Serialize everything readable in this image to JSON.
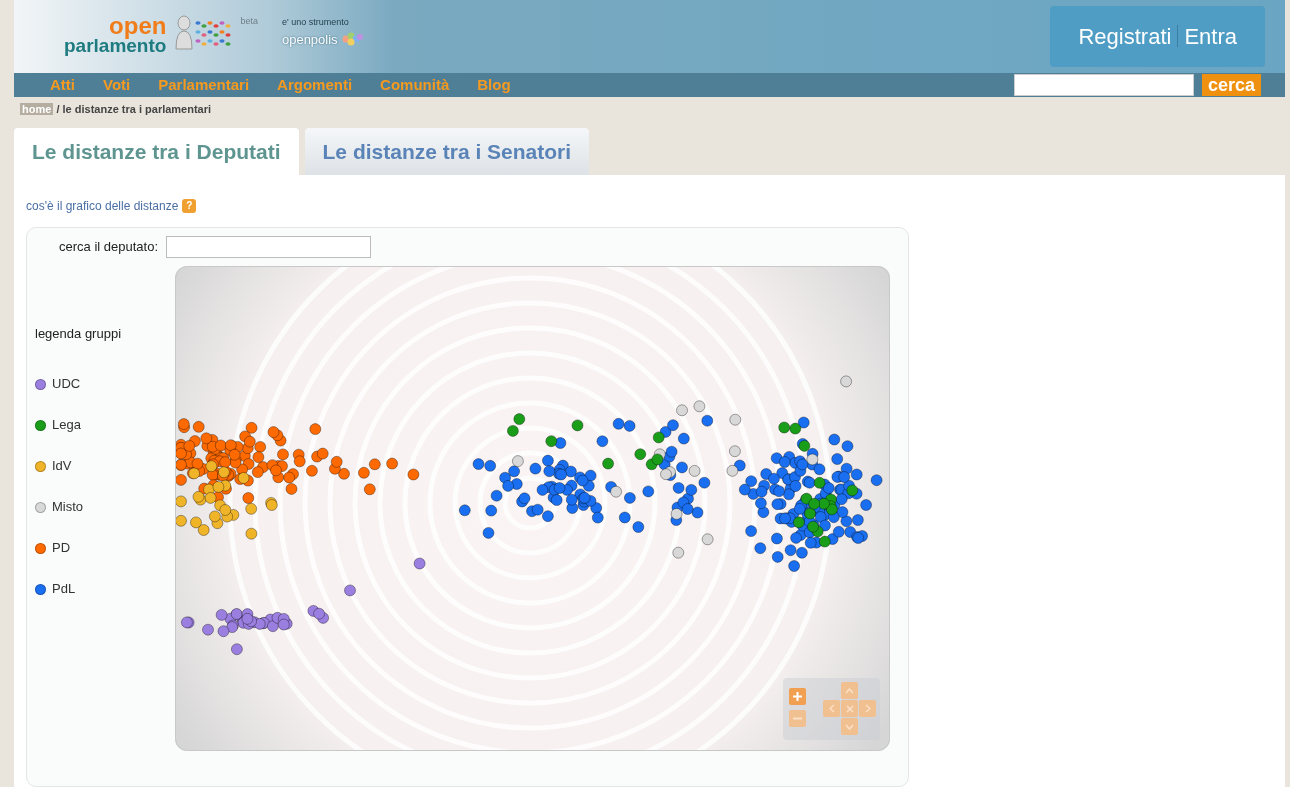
{
  "header": {
    "logo_top": "open",
    "logo_bottom": "parlamento",
    "beta": "beta",
    "tagline": "e' uno strumento",
    "openpolis": "openpolis",
    "auth_links": [
      "Registrati",
      "Entra"
    ]
  },
  "nav": {
    "items": [
      "Atti",
      "Voti",
      "Parlamentari",
      "Argomenti",
      "Comunità",
      "Blog"
    ],
    "search_button": "cerca"
  },
  "breadcrumb": {
    "home": "home",
    "current": "/ le distanze tra i parlamentari"
  },
  "tabs": [
    {
      "label": "Le distanze tra i Deputati",
      "selected": true
    },
    {
      "label": "Le distanze tra i Senatori",
      "selected": false
    }
  ],
  "help_link": "cos'è il grafico delle distanze",
  "help_icon": "?",
  "search_label": "cerca il deputato:",
  "legend": {
    "title": "legenda gruppi",
    "groups": [
      {
        "name": "UDC",
        "color": "#9b7fe0"
      },
      {
        "name": "Lega",
        "color": "#1a9e1a"
      },
      {
        "name": "IdV",
        "color": "#f0b429"
      },
      {
        "name": "Misto",
        "color": "#d8d8d8"
      },
      {
        "name": "PD",
        "color": "#ff6a00"
      },
      {
        "name": "PdL",
        "color": "#1a6ef0"
      }
    ]
  }
}
